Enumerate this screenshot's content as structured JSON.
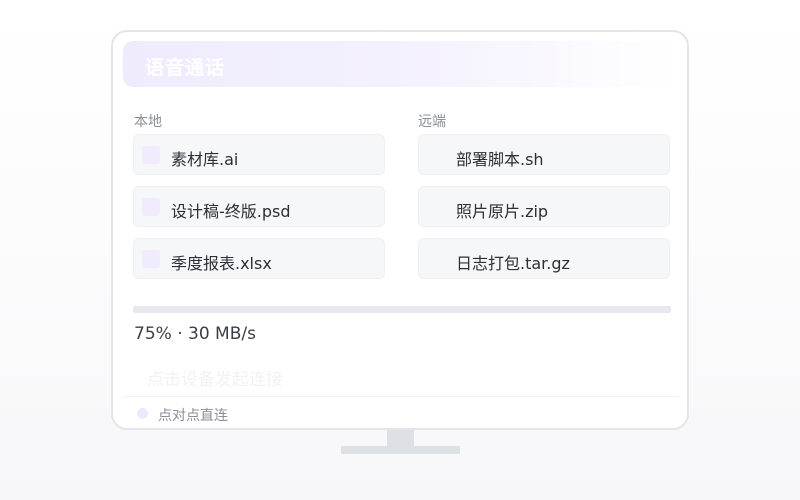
{
  "header": {
    "title": "语音通话"
  },
  "local": {
    "label": "本地",
    "files": [
      {
        "name": "素材库.ai"
      },
      {
        "name": "设计稿-终版.psd"
      },
      {
        "name": "季度报表.xlsx"
      }
    ]
  },
  "remote": {
    "label": "远端",
    "files": [
      {
        "name": "部署脚本.sh"
      },
      {
        "name": "照片原片.zip"
      },
      {
        "name": "日志打包.tar.gz"
      }
    ]
  },
  "transfer": {
    "progress_percent": 75,
    "status_text": "75% · 30 MB/s"
  },
  "connect_hint": "点击设备发起连接",
  "footer": {
    "mode_text": "点对点直连"
  },
  "colors": {
    "accent_light": "#efebfd",
    "file_icon": "#f0ebfd",
    "item_bg": "#f6f7f9",
    "progress_track": "#e6e9ed"
  }
}
